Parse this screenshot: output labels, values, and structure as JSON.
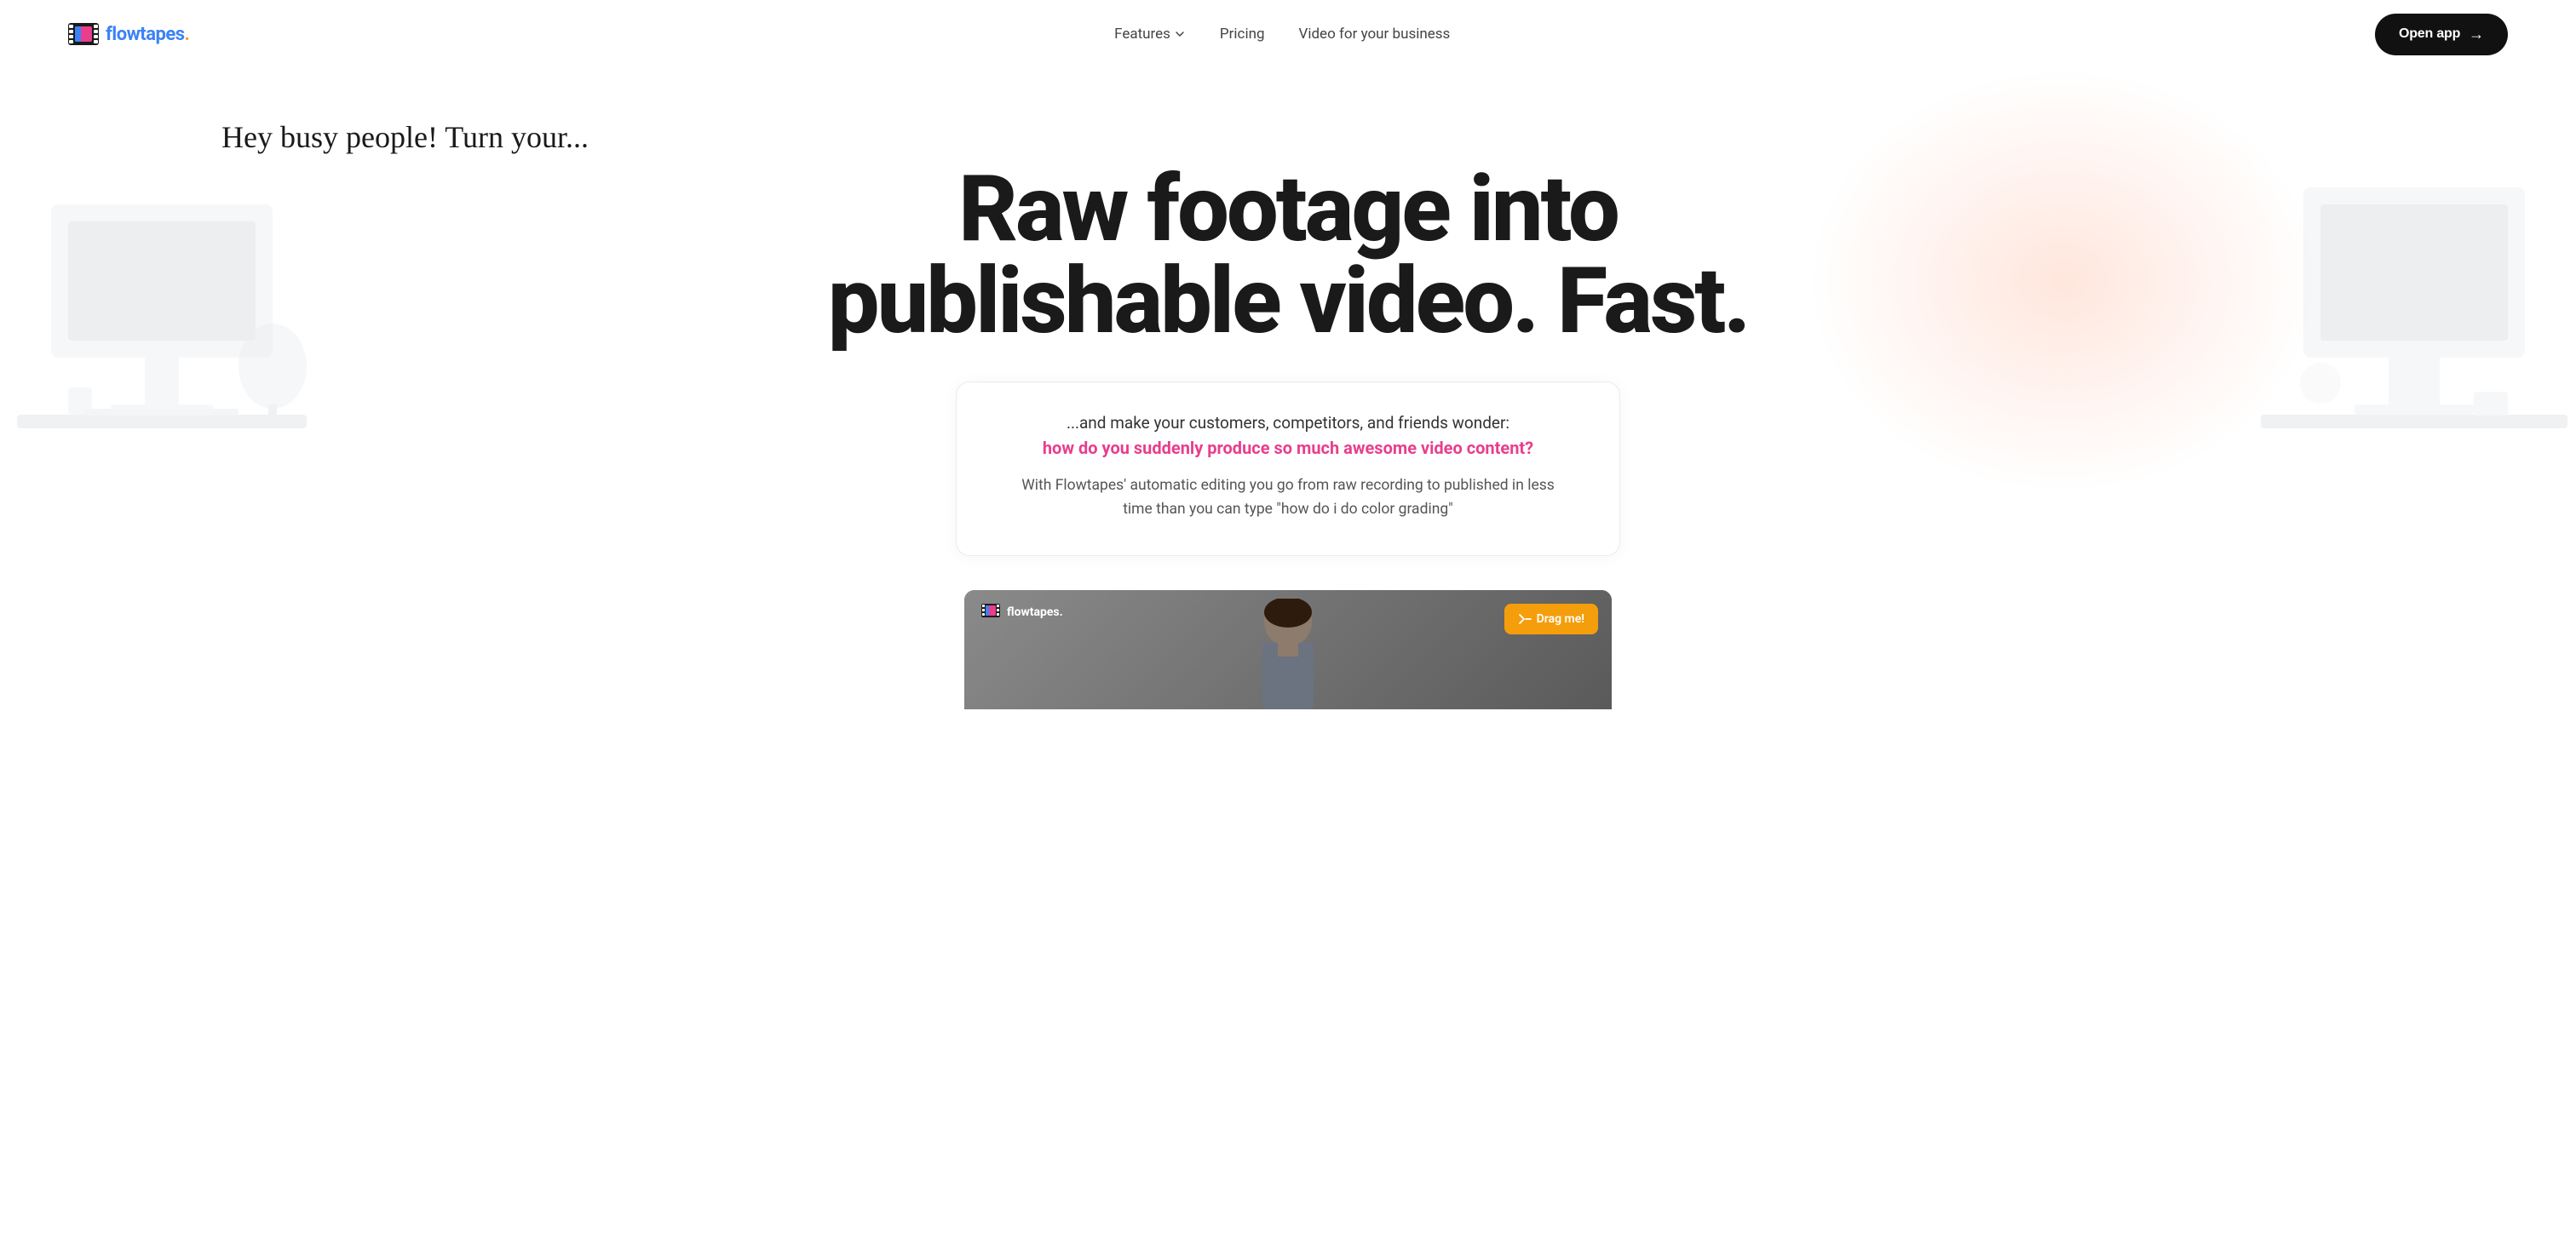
{
  "nav": {
    "logo_text": "flowtapes",
    "logo_dot": ".",
    "features_label": "Features",
    "pricing_label": "Pricing",
    "business_label": "Video for your business",
    "open_app_label": "Open app",
    "arrow": "→"
  },
  "hero": {
    "handwriting": "Hey busy people! Turn your...",
    "headline_line1": "Raw footage into",
    "headline_line2": "publishable video. Fast.",
    "wonder_text": "...and make your customers, competitors, and friends wonder:",
    "question": "how do you suddenly produce so much awesome video content?",
    "description": "With Flowtapes' automatic editing you go from raw recording to published in less time than you can type \"how do i do color grading\"",
    "drag_me_label": "Drag me!",
    "video_logo": "flowtapes."
  },
  "colors": {
    "accent_pink": "#e83e8c",
    "accent_orange": "#f59e0b",
    "btn_dark": "#111111",
    "text_dark": "#1a1a1a",
    "text_muted": "#555555"
  }
}
